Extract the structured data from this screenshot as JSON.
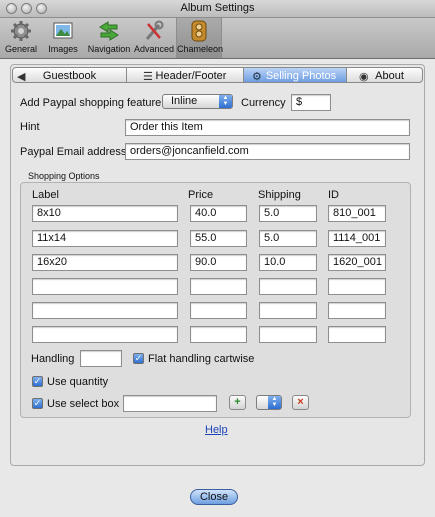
{
  "window": {
    "title": "Album Settings"
  },
  "toolbar": {
    "items": [
      {
        "label": "General",
        "icon": "gear-icon"
      },
      {
        "label": "Images",
        "icon": "photo-icon"
      },
      {
        "label": "Navigation",
        "icon": "arrows-icon"
      },
      {
        "label": "Advanced",
        "icon": "tools-icon"
      },
      {
        "label": "Chameleon",
        "icon": "chameleon-icon",
        "active": true
      }
    ]
  },
  "tabs": [
    {
      "label": "Guestbook",
      "icon": "back-arrow-icon"
    },
    {
      "label": "Header/Footer",
      "icon": "header-icon"
    },
    {
      "label": "Selling Photos",
      "icon": "selling-icon",
      "selected": true
    },
    {
      "label": "About",
      "icon": "about-icon"
    }
  ],
  "form": {
    "paypal_label": "Add Paypal shopping feature",
    "paypal_value": "Inline",
    "currency_label": "Currency",
    "currency_value": "$",
    "hint_label": "Hint",
    "hint_value": "Order this Item",
    "email_label": "Paypal Email address",
    "email_value": "orders@joncanfield.com"
  },
  "shopping": {
    "title": "Shopping Options",
    "headers": {
      "label": "Label",
      "price": "Price",
      "shipping": "Shipping",
      "id": "ID"
    },
    "rows": [
      {
        "label": "8x10",
        "price": "40.0",
        "shipping": "5.0",
        "id": "810_001"
      },
      {
        "label": "11x14",
        "price": "55.0",
        "shipping": "5.0",
        "id": "1114_001"
      },
      {
        "label": "16x20",
        "price": "90.0",
        "shipping": "10.0",
        "id": "1620_001"
      },
      {
        "label": "",
        "price": "",
        "shipping": "",
        "id": ""
      },
      {
        "label": "",
        "price": "",
        "shipping": "",
        "id": ""
      },
      {
        "label": "",
        "price": "",
        "shipping": "",
        "id": ""
      }
    ],
    "handling_label": "Handling",
    "handling_value": "",
    "flat_handling_label": "Flat handling cartwise",
    "use_quantity_label": "Use quantity",
    "use_select_box_label": "Use select box",
    "select_box_value": ""
  },
  "footer": {
    "help_label": "Help",
    "close_label": "Close"
  },
  "colors": {
    "accent": "#5b8fd9",
    "link": "#1d44b8"
  }
}
